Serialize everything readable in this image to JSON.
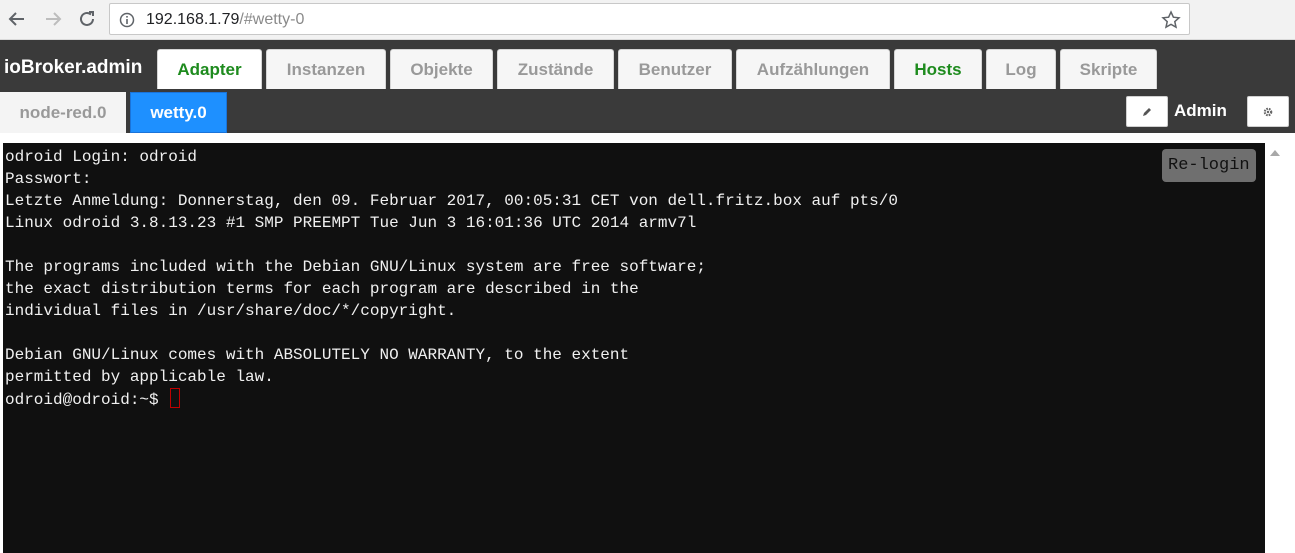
{
  "browser": {
    "url_host": "192.168.1.79",
    "url_path": "/#wetty-0"
  },
  "app": {
    "brand": "ioBroker.admin",
    "main_tabs": [
      {
        "label": "Adapter",
        "color": "#1e8b1e"
      },
      {
        "label": "Instanzen"
      },
      {
        "label": "Objekte"
      },
      {
        "label": "Zustände"
      },
      {
        "label": "Benutzer"
      },
      {
        "label": "Aufzählungen"
      },
      {
        "label": "Hosts",
        "color": "#1e8b1e"
      },
      {
        "label": "Log"
      },
      {
        "label": "Skripte"
      }
    ],
    "sub_tabs": [
      {
        "label": "node-red.0",
        "active": false
      },
      {
        "label": "wetty.0",
        "active": true
      }
    ],
    "user": "Admin"
  },
  "terminal": {
    "relogin_label": "Re-login",
    "lines": [
      "odroid Login: odroid",
      "Passwort:",
      "Letzte Anmeldung: Donnerstag, den 09. Februar 2017, 00:05:31 CET von dell.fritz.box auf pts/0",
      "Linux odroid 3.8.13.23 #1 SMP PREEMPT Tue Jun 3 16:01:36 UTC 2014 armv7l",
      "",
      "The programs included with the Debian GNU/Linux system are free software;",
      "the exact distribution terms for each program are described in the",
      "individual files in /usr/share/doc/*/copyright.",
      "",
      "Debian GNU/Linux comes with ABSOLUTELY NO WARRANTY, to the extent",
      "permitted by applicable law."
    ],
    "prompt": "odroid@odroid:~$ "
  }
}
